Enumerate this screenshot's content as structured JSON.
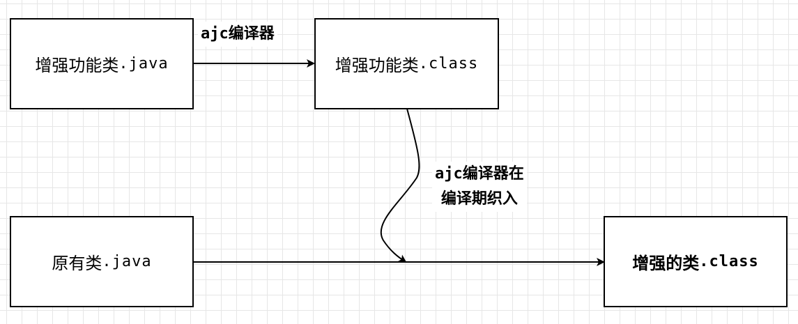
{
  "nodes": {
    "enhancer_java": {
      "name": "增强功能类",
      "ext": ".java"
    },
    "enhancer_class": {
      "name": "增强功能类",
      "ext": ".class"
    },
    "original_java": {
      "name": "原有类",
      "ext": ".java"
    },
    "enhanced_class": {
      "name": "增强的类",
      "ext": ".class"
    }
  },
  "edges": {
    "compile": {
      "label_prefix": "ajc",
      "label_text": "编译器"
    },
    "weave": {
      "line1_prefix": "ajc",
      "line1_text": "编译器在",
      "line2": "编译期织入"
    }
  },
  "colors": {
    "stroke": "#000000",
    "grid": "#e6e6e6",
    "background": "#ffffff"
  }
}
